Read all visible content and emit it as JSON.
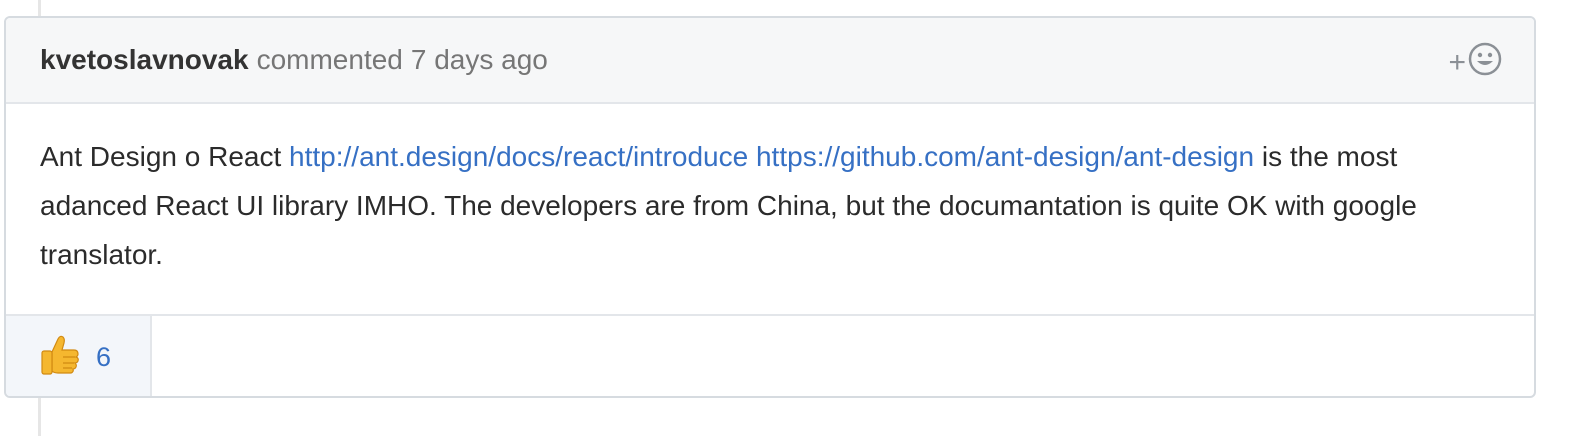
{
  "comment": {
    "author": "kvetoslavnovak",
    "action_text": "commented",
    "time_ago": "7 days ago",
    "add_reaction_label": "+",
    "body": {
      "prefix": "Ant Design o React ",
      "link1": "http://ant.design/docs/react/introduce",
      "link2": "https://github.com/ant-design/ant-design",
      "suffix": " is the most adanced React UI library IMHO. The developers are from China, but the documantation is quite OK with google translator."
    },
    "reactions": [
      {
        "icon": "thumbs-up-icon",
        "count": "6"
      }
    ]
  },
  "colors": {
    "link": "#3670c4",
    "header_bg": "#f6f7f8",
    "border": "#d6dbe0",
    "reaction_bg": "#f3f6fa"
  }
}
